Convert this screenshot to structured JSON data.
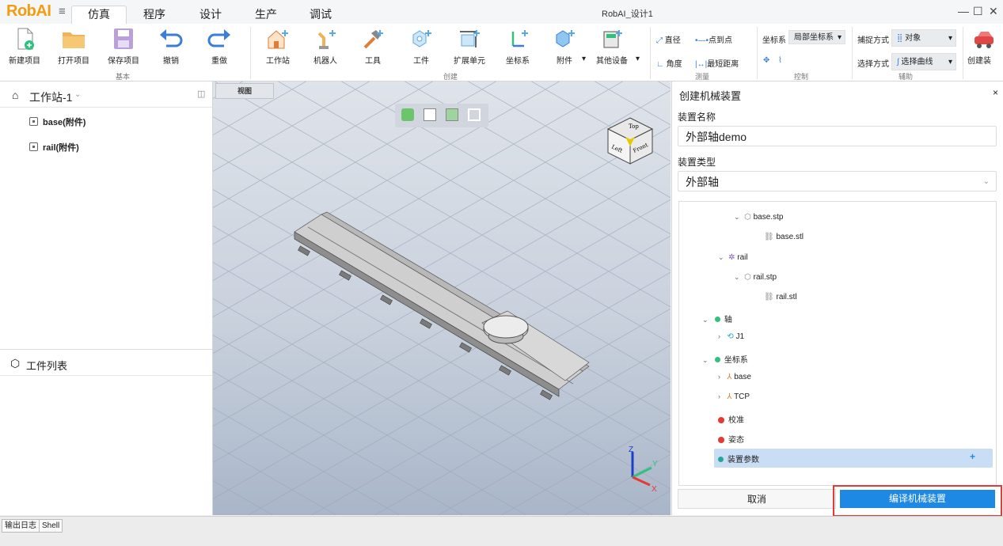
{
  "app": {
    "logo": "RobAI",
    "window_title": "RobAI_设计1"
  },
  "menu_tabs": [
    "仿真",
    "程序",
    "设计",
    "生产",
    "调试"
  ],
  "ribbon": {
    "buttons": [
      {
        "label": "新建项目",
        "icon": "new-file-icon"
      },
      {
        "label": "打开项目",
        "icon": "folder-icon"
      },
      {
        "label": "保存项目",
        "icon": "save-icon"
      },
      {
        "label": "撤销",
        "icon": "undo-icon"
      },
      {
        "label": "重做",
        "icon": "redo-icon"
      },
      {
        "label": "工作站",
        "icon": "workstation-icon"
      },
      {
        "label": "机器人",
        "icon": "robot-icon"
      },
      {
        "label": "工具",
        "icon": "tool-icon"
      },
      {
        "label": "工件",
        "icon": "workpiece-icon"
      },
      {
        "label": "扩展单元",
        "icon": "extension-unit-icon"
      },
      {
        "label": "坐标系",
        "icon": "frame-icon"
      },
      {
        "label": "附件",
        "icon": "attachment-icon"
      },
      {
        "label": "其他设备",
        "icon": "device-icon"
      },
      {
        "label": "创建装",
        "icon": "create-device-icon"
      }
    ],
    "groups": {
      "basic": "基本",
      "create": "创建",
      "measure": "测量",
      "control": "控制",
      "assist": "辅助"
    },
    "measure": {
      "diameter": "直径",
      "point_to_point": "点到点",
      "angle": "角度",
      "min_distance": "最短距离"
    },
    "control": {
      "frame_label": "坐标系",
      "frame_value": "局部坐标系"
    },
    "assist": {
      "capture_label": "捕捉方式",
      "capture_value": "对象",
      "select_label": "选择方式",
      "select_value": "选择曲线"
    }
  },
  "left_panel": {
    "station": "工作站-1",
    "items": [
      "base(附件)",
      "rail(附件)"
    ],
    "workpiece_list": "工件列表"
  },
  "viewport": {
    "tab": "视图",
    "cube": {
      "top": "Top",
      "left": "Left",
      "front": "Front"
    },
    "axes": {
      "x": "X",
      "y": "Y",
      "z": "Z"
    }
  },
  "right_panel": {
    "title": "创建机械装置",
    "name_label": "装置名称",
    "name_value": "外部轴demo",
    "type_label": "装置类型",
    "type_value": "外部轴",
    "tree": {
      "base_stp": "base.stp",
      "base_stl": "base.stl",
      "rail": "rail",
      "rail_stp": "rail.stp",
      "rail_stl": "rail.stl",
      "axis": "轴",
      "j1": "J1",
      "frames": "坐标系",
      "base": "base",
      "tcp": "TCP",
      "calibration": "校准",
      "pose": "姿态",
      "params": "装置参数"
    },
    "cancel": "取消",
    "compile": "编译机械装置"
  },
  "status": {
    "log": "输出日志",
    "shell": "Shell"
  }
}
